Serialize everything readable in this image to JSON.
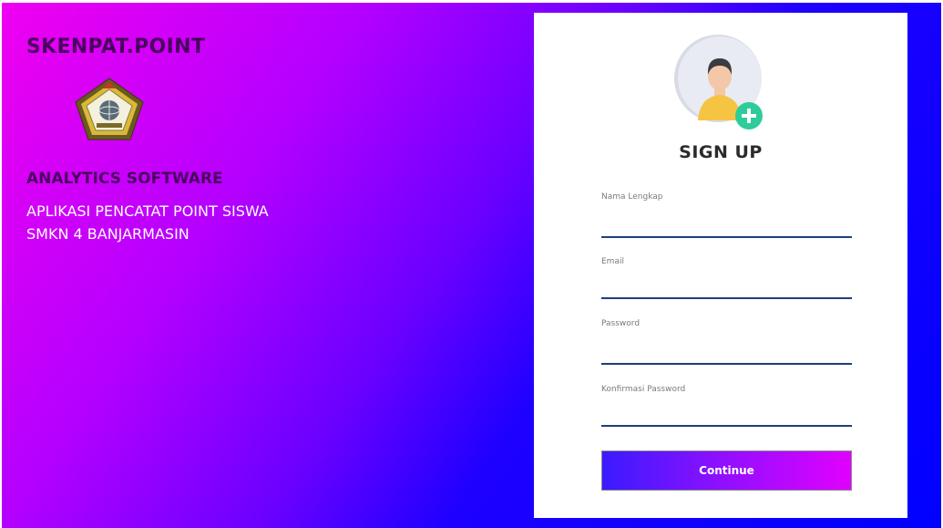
{
  "sidebar": {
    "brand": "SKENPAT.POINT",
    "subtitle": "ANALYTICS SOFTWARE",
    "description_line1": "APLIKASI PENCATAT POINT SISWA",
    "description_line2": "SMKN 4 BANJARMASIN",
    "logo_icon": "school-emblem-icon"
  },
  "form": {
    "avatar_icon": "user-add-avatar-icon",
    "title": "SIGN UP",
    "fields": [
      {
        "label": "Nama Lengkap",
        "value": ""
      },
      {
        "label": "Email",
        "value": ""
      },
      {
        "label": "Password",
        "value": ""
      },
      {
        "label": "Konfirmasi Password",
        "value": ""
      }
    ],
    "submit_label": "Continue"
  },
  "colors": {
    "gradient_start": "#f000f0",
    "gradient_end": "#0000ff",
    "brand_text": "#4a0060",
    "input_underline": "#1f3f78",
    "plus_badge": "#2ecc9a"
  }
}
